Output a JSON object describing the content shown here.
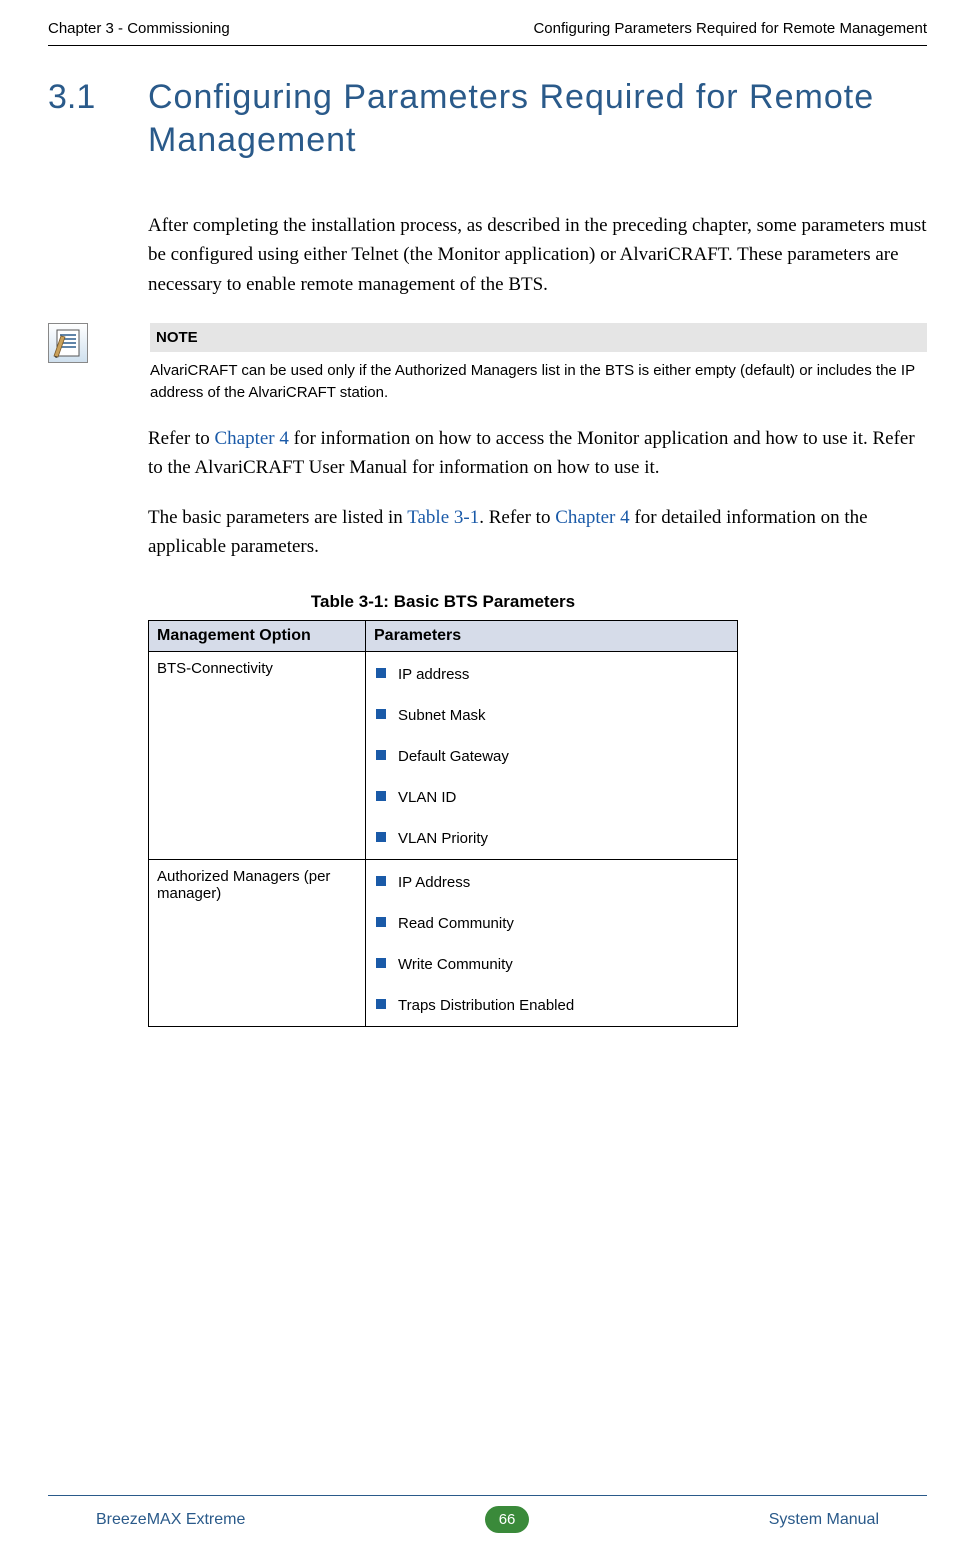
{
  "header": {
    "left": "Chapter 3 - Commissioning",
    "right": "Configuring Parameters Required for Remote Management"
  },
  "section": {
    "number": "3.1",
    "title": "Configuring Parameters Required for Remote Management"
  },
  "para1": "After completing the installation process, as described in the preceding chapter, some parameters must be configured using either Telnet (the Monitor application) or AlvariCRAFT. These parameters are necessary to enable remote management of the BTS.",
  "note": {
    "label": "NOTE",
    "text": "AlvariCRAFT can be used only if the Authorized Managers list in the BTS is either empty (default) or includes the IP address of the AlvariCRAFT station."
  },
  "para2": {
    "pre": "Refer to ",
    "link1": "Chapter 4",
    "mid": " for information on how to access the Monitor application and how to use it. Refer to the AlvariCRAFT User Manual for information on how to use it."
  },
  "para3": {
    "pre": "The basic parameters are listed in ",
    "link1": "Table 3-1",
    "mid": ". Refer to ",
    "link2": "Chapter 4",
    "post": " for detailed information on the applicable parameters."
  },
  "table": {
    "caption": "Table 3-1: Basic BTS Parameters",
    "headers": {
      "col1": "Management Option",
      "col2": "Parameters"
    },
    "rows": [
      {
        "option": "BTS-Connectivity",
        "params": [
          "IP address",
          "Subnet Mask",
          "Default Gateway",
          "VLAN ID",
          "VLAN Priority"
        ]
      },
      {
        "option": "Authorized Managers (per manager)",
        "params": [
          "IP Address",
          "Read Community",
          "Write Community",
          "Traps Distribution Enabled"
        ]
      }
    ]
  },
  "footer": {
    "left": "BreezeMAX Extreme",
    "page": "66",
    "right": "System Manual"
  }
}
